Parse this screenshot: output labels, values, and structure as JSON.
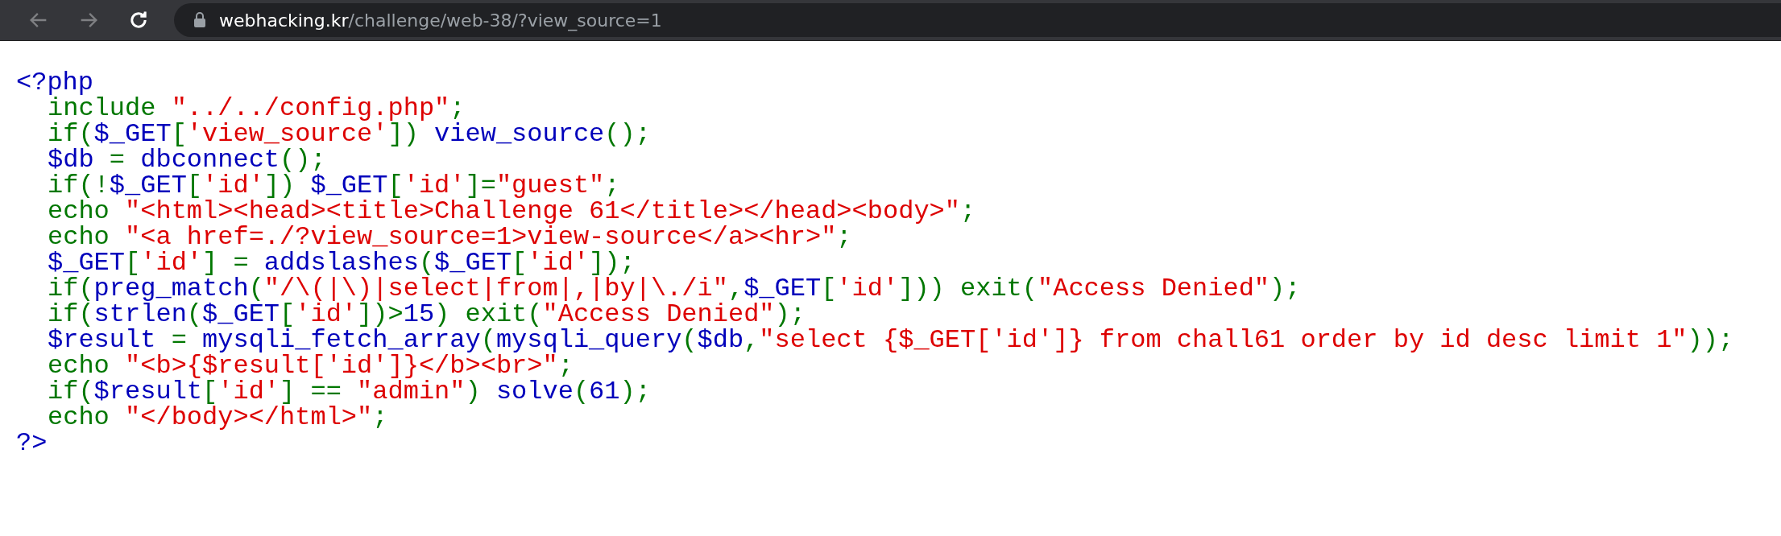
{
  "browser": {
    "back_disabled": true,
    "forward_disabled": true,
    "url_host": "webhacking.kr",
    "url_path": "/challenge/web-38/?view_source=1"
  },
  "code_lines": [
    {
      "indented": false,
      "tokens": [
        {
          "kind": "default",
          "text": "<?php"
        }
      ]
    },
    {
      "indented": true,
      "tokens": [
        {
          "kind": "keyword",
          "text": "include "
        },
        {
          "kind": "string",
          "text": "\"../../config.php\""
        },
        {
          "kind": "keyword",
          "text": ";"
        }
      ]
    },
    {
      "indented": true,
      "tokens": [
        {
          "kind": "keyword",
          "text": "if("
        },
        {
          "kind": "default",
          "text": "$_GET"
        },
        {
          "kind": "keyword",
          "text": "["
        },
        {
          "kind": "string",
          "text": "'view_source'"
        },
        {
          "kind": "keyword",
          "text": "]) "
        },
        {
          "kind": "default",
          "text": "view_source"
        },
        {
          "kind": "keyword",
          "text": "();"
        }
      ]
    },
    {
      "indented": true,
      "tokens": [
        {
          "kind": "default",
          "text": "$db "
        },
        {
          "kind": "keyword",
          "text": "= "
        },
        {
          "kind": "default",
          "text": "dbconnect"
        },
        {
          "kind": "keyword",
          "text": "();"
        }
      ]
    },
    {
      "indented": true,
      "tokens": [
        {
          "kind": "keyword",
          "text": "if(!"
        },
        {
          "kind": "default",
          "text": "$_GET"
        },
        {
          "kind": "keyword",
          "text": "["
        },
        {
          "kind": "string",
          "text": "'id'"
        },
        {
          "kind": "keyword",
          "text": "]) "
        },
        {
          "kind": "default",
          "text": "$_GET"
        },
        {
          "kind": "keyword",
          "text": "["
        },
        {
          "kind": "string",
          "text": "'id'"
        },
        {
          "kind": "keyword",
          "text": "]="
        },
        {
          "kind": "string",
          "text": "\"guest\""
        },
        {
          "kind": "keyword",
          "text": ";"
        }
      ]
    },
    {
      "indented": true,
      "tokens": [
        {
          "kind": "keyword",
          "text": "echo "
        },
        {
          "kind": "string",
          "text": "\"<html><head><title>Challenge 61</title></head><body>\""
        },
        {
          "kind": "keyword",
          "text": ";"
        }
      ]
    },
    {
      "indented": true,
      "tokens": [
        {
          "kind": "keyword",
          "text": "echo "
        },
        {
          "kind": "string",
          "text": "\"<a href=./?view_source=1>view-source</a><hr>\""
        },
        {
          "kind": "keyword",
          "text": ";"
        }
      ]
    },
    {
      "indented": true,
      "tokens": [
        {
          "kind": "default",
          "text": "$_GET"
        },
        {
          "kind": "keyword",
          "text": "["
        },
        {
          "kind": "string",
          "text": "'id'"
        },
        {
          "kind": "keyword",
          "text": "] = "
        },
        {
          "kind": "default",
          "text": "addslashes"
        },
        {
          "kind": "keyword",
          "text": "("
        },
        {
          "kind": "default",
          "text": "$_GET"
        },
        {
          "kind": "keyword",
          "text": "["
        },
        {
          "kind": "string",
          "text": "'id'"
        },
        {
          "kind": "keyword",
          "text": "]);"
        }
      ]
    },
    {
      "indented": true,
      "tokens": [
        {
          "kind": "keyword",
          "text": "if("
        },
        {
          "kind": "default",
          "text": "preg_match"
        },
        {
          "kind": "keyword",
          "text": "("
        },
        {
          "kind": "string",
          "text": "\"/\\(|\\)|select|from|,|by|\\./i\""
        },
        {
          "kind": "keyword",
          "text": ","
        },
        {
          "kind": "default",
          "text": "$_GET"
        },
        {
          "kind": "keyword",
          "text": "["
        },
        {
          "kind": "string",
          "text": "'id'"
        },
        {
          "kind": "keyword",
          "text": "])) exit("
        },
        {
          "kind": "string",
          "text": "\"Access Denied\""
        },
        {
          "kind": "keyword",
          "text": ");"
        }
      ]
    },
    {
      "indented": true,
      "tokens": [
        {
          "kind": "keyword",
          "text": "if("
        },
        {
          "kind": "default",
          "text": "strlen"
        },
        {
          "kind": "keyword",
          "text": "("
        },
        {
          "kind": "default",
          "text": "$_GET"
        },
        {
          "kind": "keyword",
          "text": "["
        },
        {
          "kind": "string",
          "text": "'id'"
        },
        {
          "kind": "keyword",
          "text": "])>"
        },
        {
          "kind": "default",
          "text": "15"
        },
        {
          "kind": "keyword",
          "text": ") exit("
        },
        {
          "kind": "string",
          "text": "\"Access Denied\""
        },
        {
          "kind": "keyword",
          "text": ");"
        }
      ]
    },
    {
      "indented": true,
      "tokens": [
        {
          "kind": "default",
          "text": "$result "
        },
        {
          "kind": "keyword",
          "text": "= "
        },
        {
          "kind": "default",
          "text": "mysqli_fetch_array"
        },
        {
          "kind": "keyword",
          "text": "("
        },
        {
          "kind": "default",
          "text": "mysqli_query"
        },
        {
          "kind": "keyword",
          "text": "("
        },
        {
          "kind": "default",
          "text": "$db"
        },
        {
          "kind": "keyword",
          "text": ","
        },
        {
          "kind": "string",
          "text": "\"select {$_GET['id']} from chall61 order by id desc limit 1\""
        },
        {
          "kind": "keyword",
          "text": "));"
        }
      ]
    },
    {
      "indented": true,
      "tokens": [
        {
          "kind": "keyword",
          "text": "echo "
        },
        {
          "kind": "string",
          "text": "\"<b>{$result['id']}</b><br>\""
        },
        {
          "kind": "keyword",
          "text": ";"
        }
      ]
    },
    {
      "indented": true,
      "tokens": [
        {
          "kind": "keyword",
          "text": "if("
        },
        {
          "kind": "default",
          "text": "$result"
        },
        {
          "kind": "keyword",
          "text": "["
        },
        {
          "kind": "string",
          "text": "'id'"
        },
        {
          "kind": "keyword",
          "text": "] == "
        },
        {
          "kind": "string",
          "text": "\"admin\""
        },
        {
          "kind": "keyword",
          "text": ") "
        },
        {
          "kind": "default",
          "text": "solve"
        },
        {
          "kind": "keyword",
          "text": "("
        },
        {
          "kind": "default",
          "text": "61"
        },
        {
          "kind": "keyword",
          "text": ");"
        }
      ]
    },
    {
      "indented": true,
      "tokens": [
        {
          "kind": "keyword",
          "text": "echo "
        },
        {
          "kind": "string",
          "text": "\"</body></html>\""
        },
        {
          "kind": "keyword",
          "text": ";"
        }
      ]
    },
    {
      "indented": false,
      "tokens": [
        {
          "kind": "default",
          "text": "?>"
        }
      ]
    }
  ]
}
